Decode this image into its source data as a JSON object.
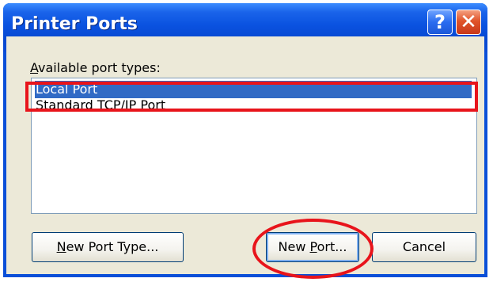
{
  "window": {
    "title": "Printer Ports",
    "help_label": "?",
    "close_label": "✕"
  },
  "dialog": {
    "available_label_hotkey": "A",
    "available_label_rest": "vailable port types:",
    "port_types": [
      "Local Port",
      "Standard TCP/IP Port"
    ],
    "selected_index": 0
  },
  "buttons": {
    "new_port_type_hotkey": "N",
    "new_port_type_rest": "ew Port Type...",
    "new_port_prefix": "New ",
    "new_port_hotkey": "P",
    "new_port_rest": "ort...",
    "cancel": "Cancel"
  },
  "annotations": {
    "highlight_color": "#e8141b"
  },
  "colors": {
    "titlebar": "#0a52e0",
    "selection": "#316ac5",
    "client": "#ece9d8",
    "button_border": "#003c74"
  }
}
